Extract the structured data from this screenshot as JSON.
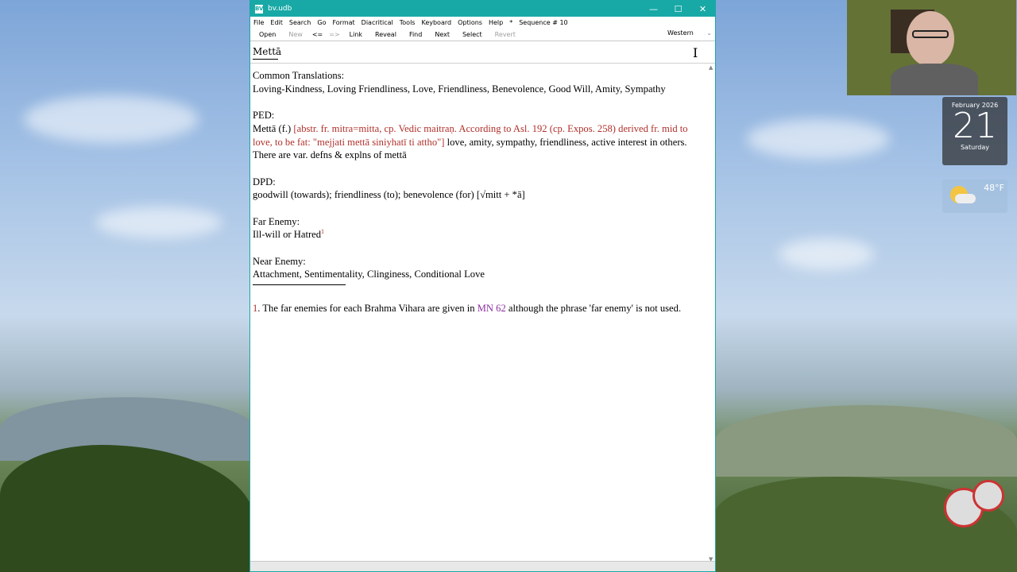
{
  "window": {
    "title": "bv.udb",
    "app_icon": "BV",
    "controls": [
      "minimize-icon",
      "maximize-icon",
      "close-icon"
    ]
  },
  "menu": {
    "items": [
      "File",
      "Edit",
      "Search",
      "Go",
      "Format",
      "Diacritical",
      "Tools",
      "Keyboard",
      "Options",
      "Help",
      "*",
      "Sequence # 10"
    ]
  },
  "toolbar": {
    "open": "Open",
    "new": "New",
    "back": "<=",
    "forward": "=>",
    "link": "Link",
    "reveal": "Reveal",
    "find": "Find",
    "next": "Next",
    "select": "Select",
    "revert": "Revert",
    "language": "Western"
  },
  "entry": {
    "word": "Mettā",
    "common_heading": "Common Translations:",
    "common_text": "Loving-Kindness, Loving Friendliness, Love, Friendliness, Benevolence, Good Will, Amity, Sympathy",
    "ped_heading": "PED:",
    "ped_word": "Mettā (f.) ",
    "ped_red": "[abstr. fr. mitra=mitta, cp. Vedic maitraṇ. According to Asl. 192 (cp. Expos. 258) derived fr. mid to love, to be fat: \"mejjati mettā siniyhatī ti attho\"]",
    "ped_rest": " love, amity, sympathy, friendliness, active interest in others. There are var. defns & explns of mettā",
    "dpd_heading": "DPD:",
    "dpd_text": "goodwill (towards); friendliness (to); benevolence (for) [√mitt + *ā]",
    "far_heading": "Far Enemy:",
    "far_text": "Ill-will or Hatred",
    "far_sup": "1",
    "near_heading": "Near Enemy:",
    "near_text": "Attachment, Sentimentality, Clinginess, Conditional Love",
    "footnote_num": "1",
    "footnote_pre": ". The far enemies for each Brahma Vihara are given in ",
    "footnote_link": "MN 62",
    "footnote_post": " although the phrase 'far enemy' is not used."
  },
  "desktop": {
    "calendar_month": "February 2026",
    "calendar_day": "21",
    "calendar_dow": "Saturday",
    "weather_temp": "48°F",
    "colors": {
      "titlebar": "#18a9a6",
      "red_text": "#b0302a",
      "link_purple": "#8b2fa0"
    }
  }
}
